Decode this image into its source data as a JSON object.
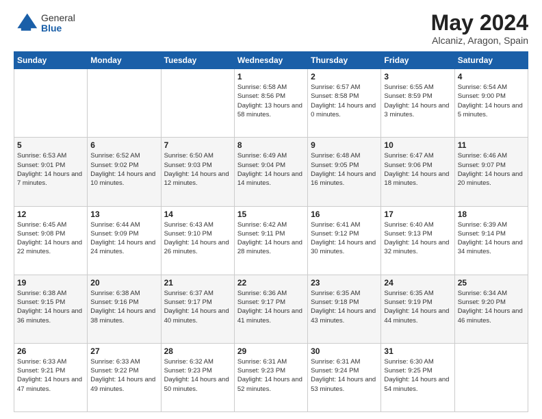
{
  "logo": {
    "general": "General",
    "blue": "Blue"
  },
  "title": "May 2024",
  "location": "Alcaniz, Aragon, Spain",
  "days_of_week": [
    "Sunday",
    "Monday",
    "Tuesday",
    "Wednesday",
    "Thursday",
    "Friday",
    "Saturday"
  ],
  "weeks": [
    [
      {
        "day": "",
        "info": ""
      },
      {
        "day": "",
        "info": ""
      },
      {
        "day": "",
        "info": ""
      },
      {
        "day": "1",
        "info": "Sunrise: 6:58 AM\nSunset: 8:56 PM\nDaylight: 13 hours\nand 58 minutes."
      },
      {
        "day": "2",
        "info": "Sunrise: 6:57 AM\nSunset: 8:58 PM\nDaylight: 14 hours\nand 0 minutes."
      },
      {
        "day": "3",
        "info": "Sunrise: 6:55 AM\nSunset: 8:59 PM\nDaylight: 14 hours\nand 3 minutes."
      },
      {
        "day": "4",
        "info": "Sunrise: 6:54 AM\nSunset: 9:00 PM\nDaylight: 14 hours\nand 5 minutes."
      }
    ],
    [
      {
        "day": "5",
        "info": "Sunrise: 6:53 AM\nSunset: 9:01 PM\nDaylight: 14 hours\nand 7 minutes."
      },
      {
        "day": "6",
        "info": "Sunrise: 6:52 AM\nSunset: 9:02 PM\nDaylight: 14 hours\nand 10 minutes."
      },
      {
        "day": "7",
        "info": "Sunrise: 6:50 AM\nSunset: 9:03 PM\nDaylight: 14 hours\nand 12 minutes."
      },
      {
        "day": "8",
        "info": "Sunrise: 6:49 AM\nSunset: 9:04 PM\nDaylight: 14 hours\nand 14 minutes."
      },
      {
        "day": "9",
        "info": "Sunrise: 6:48 AM\nSunset: 9:05 PM\nDaylight: 14 hours\nand 16 minutes."
      },
      {
        "day": "10",
        "info": "Sunrise: 6:47 AM\nSunset: 9:06 PM\nDaylight: 14 hours\nand 18 minutes."
      },
      {
        "day": "11",
        "info": "Sunrise: 6:46 AM\nSunset: 9:07 PM\nDaylight: 14 hours\nand 20 minutes."
      }
    ],
    [
      {
        "day": "12",
        "info": "Sunrise: 6:45 AM\nSunset: 9:08 PM\nDaylight: 14 hours\nand 22 minutes."
      },
      {
        "day": "13",
        "info": "Sunrise: 6:44 AM\nSunset: 9:09 PM\nDaylight: 14 hours\nand 24 minutes."
      },
      {
        "day": "14",
        "info": "Sunrise: 6:43 AM\nSunset: 9:10 PM\nDaylight: 14 hours\nand 26 minutes."
      },
      {
        "day": "15",
        "info": "Sunrise: 6:42 AM\nSunset: 9:11 PM\nDaylight: 14 hours\nand 28 minutes."
      },
      {
        "day": "16",
        "info": "Sunrise: 6:41 AM\nSunset: 9:12 PM\nDaylight: 14 hours\nand 30 minutes."
      },
      {
        "day": "17",
        "info": "Sunrise: 6:40 AM\nSunset: 9:13 PM\nDaylight: 14 hours\nand 32 minutes."
      },
      {
        "day": "18",
        "info": "Sunrise: 6:39 AM\nSunset: 9:14 PM\nDaylight: 14 hours\nand 34 minutes."
      }
    ],
    [
      {
        "day": "19",
        "info": "Sunrise: 6:38 AM\nSunset: 9:15 PM\nDaylight: 14 hours\nand 36 minutes."
      },
      {
        "day": "20",
        "info": "Sunrise: 6:38 AM\nSunset: 9:16 PM\nDaylight: 14 hours\nand 38 minutes."
      },
      {
        "day": "21",
        "info": "Sunrise: 6:37 AM\nSunset: 9:17 PM\nDaylight: 14 hours\nand 40 minutes."
      },
      {
        "day": "22",
        "info": "Sunrise: 6:36 AM\nSunset: 9:17 PM\nDaylight: 14 hours\nand 41 minutes."
      },
      {
        "day": "23",
        "info": "Sunrise: 6:35 AM\nSunset: 9:18 PM\nDaylight: 14 hours\nand 43 minutes."
      },
      {
        "day": "24",
        "info": "Sunrise: 6:35 AM\nSunset: 9:19 PM\nDaylight: 14 hours\nand 44 minutes."
      },
      {
        "day": "25",
        "info": "Sunrise: 6:34 AM\nSunset: 9:20 PM\nDaylight: 14 hours\nand 46 minutes."
      }
    ],
    [
      {
        "day": "26",
        "info": "Sunrise: 6:33 AM\nSunset: 9:21 PM\nDaylight: 14 hours\nand 47 minutes."
      },
      {
        "day": "27",
        "info": "Sunrise: 6:33 AM\nSunset: 9:22 PM\nDaylight: 14 hours\nand 49 minutes."
      },
      {
        "day": "28",
        "info": "Sunrise: 6:32 AM\nSunset: 9:23 PM\nDaylight: 14 hours\nand 50 minutes."
      },
      {
        "day": "29",
        "info": "Sunrise: 6:31 AM\nSunset: 9:23 PM\nDaylight: 14 hours\nand 52 minutes."
      },
      {
        "day": "30",
        "info": "Sunrise: 6:31 AM\nSunset: 9:24 PM\nDaylight: 14 hours\nand 53 minutes."
      },
      {
        "day": "31",
        "info": "Sunrise: 6:30 AM\nSunset: 9:25 PM\nDaylight: 14 hours\nand 54 minutes."
      },
      {
        "day": "",
        "info": ""
      }
    ]
  ]
}
